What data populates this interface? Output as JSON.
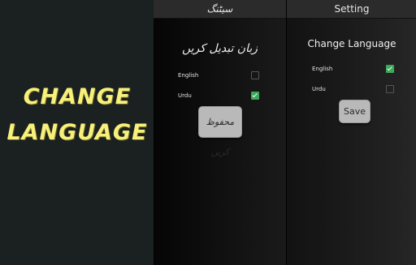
{
  "promo": {
    "line1": "CHANGE",
    "line2": "LANGUAGE",
    "color": "#f7f07a"
  },
  "urdu_screen": {
    "title": "سیٹنگ",
    "heading": "زبان تبدیل کریں",
    "options": [
      {
        "label": "English",
        "checked": false
      },
      {
        "label": "Urdu",
        "checked": true
      }
    ],
    "save_label": "محفوظ کریں"
  },
  "english_screen": {
    "title": "Setting",
    "heading": "Change Language",
    "options": [
      {
        "label": "English",
        "checked": true
      },
      {
        "label": "Urdu",
        "checked": false
      }
    ],
    "save_label": "Save"
  },
  "colors": {
    "background": "#1b2021",
    "check_accent": "#3ca85a",
    "button": "#b9b9b9"
  }
}
